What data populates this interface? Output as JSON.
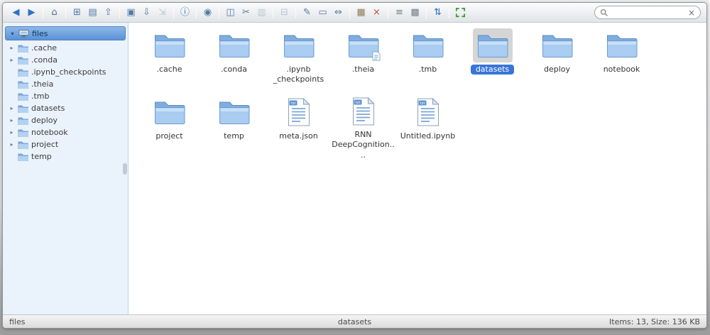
{
  "colors": {
    "accent": "#3875d7",
    "selection_icon_bg": "#d5d5d5",
    "sidebar_bg": "#eaf2fc",
    "tree_selected_top": "#8db7e9",
    "tree_selected_bottom": "#5a92d5"
  },
  "icons": {
    "expanded_arrow": "▾",
    "collapsed_arrow": "▸"
  },
  "search": {
    "placeholder": "",
    "clear_glyph": "×"
  },
  "toolbar": {
    "groups": [
      [
        {
          "name": "back",
          "glyph": "◀",
          "color": "#2d72c4"
        },
        {
          "name": "forward",
          "glyph": "▶",
          "color": "#2d72c4"
        }
      ],
      [
        {
          "name": "home",
          "glyph": "⌂",
          "color": "#4f7396"
        }
      ],
      [
        {
          "name": "new-folder",
          "glyph": "⊞",
          "color": "#4f7aa8"
        },
        {
          "name": "new-file",
          "glyph": "▤",
          "color": "#4f7aa8"
        },
        {
          "name": "upload",
          "glyph": "⇧",
          "color": "#4f7aa8"
        }
      ],
      [
        {
          "name": "open",
          "glyph": "▣",
          "color": "#4f7aa8"
        },
        {
          "name": "download",
          "glyph": "⇩",
          "color": "#4f7aa8"
        },
        {
          "name": "get-url",
          "glyph": "⇲",
          "color": "#4f7aa8",
          "disabled": true
        }
      ],
      [
        {
          "name": "info",
          "glyph": "ⓘ",
          "color": "#2d72c4"
        }
      ],
      [
        {
          "name": "preview",
          "glyph": "◉",
          "color": "#4f7aa8"
        }
      ],
      [
        {
          "name": "copy",
          "glyph": "◫",
          "color": "#4f7aa8"
        },
        {
          "name": "cut",
          "glyph": "✂",
          "color": "#4f7aa8"
        },
        {
          "name": "paste",
          "glyph": "▥",
          "color": "#4f7aa8",
          "disabled": true
        }
      ],
      [
        {
          "name": "duplicate",
          "glyph": "⊟",
          "color": "#4f7aa8",
          "disabled": true
        }
      ],
      [
        {
          "name": "rename",
          "glyph": "✎",
          "color": "#4f7aa8"
        },
        {
          "name": "edit",
          "glyph": "▭",
          "color": "#4f7aa8"
        },
        {
          "name": "resize",
          "glyph": "⇔",
          "color": "#4f7aa8"
        }
      ],
      [
        {
          "name": "archive",
          "glyph": "▦",
          "color": "#8a7a50"
        },
        {
          "name": "delete",
          "glyph": "×",
          "color": "#c0504d"
        }
      ],
      [
        {
          "name": "view-list",
          "glyph": "≡",
          "color": "#6f7e8c"
        },
        {
          "name": "view-icons",
          "glyph": "▩",
          "color": "#6f7e8c"
        }
      ],
      [
        {
          "name": "sort",
          "glyph": "⇅",
          "color": "#2d72c4"
        }
      ],
      [
        {
          "name": "fullscreen",
          "icon": "fullscreen-arrows",
          "color": "#3f9c3f"
        }
      ]
    ]
  },
  "sidebar": {
    "root": {
      "label": "files",
      "expanded": true
    },
    "items": [
      {
        "label": ".cache",
        "expandable": true
      },
      {
        "label": ".conda",
        "expandable": true
      },
      {
        "label": ".ipynb_checkpoints",
        "expandable": false
      },
      {
        "label": ".theia",
        "expandable": false
      },
      {
        "label": ".tmb",
        "expandable": false
      },
      {
        "label": "datasets",
        "expandable": true
      },
      {
        "label": "deploy",
        "expandable": true
      },
      {
        "label": "notebook",
        "expandable": true
      },
      {
        "label": "project",
        "expandable": true
      },
      {
        "label": "temp",
        "expandable": false
      }
    ]
  },
  "files": [
    {
      "label": ".cache",
      "type": "folder"
    },
    {
      "label": ".conda",
      "type": "folder"
    },
    {
      "label": ".ipynb_checkpoints",
      "lines": [
        ".ipynb",
        "_checkpoints"
      ],
      "type": "folder"
    },
    {
      "label": ".theia",
      "type": "folder",
      "badge": true
    },
    {
      "label": ".tmb",
      "type": "folder"
    },
    {
      "label": "datasets",
      "type": "folder",
      "selected": true
    },
    {
      "label": "deploy",
      "type": "folder"
    },
    {
      "label": "notebook",
      "type": "folder"
    },
    {
      "label": "project",
      "type": "folder"
    },
    {
      "label": "temp",
      "type": "folder"
    },
    {
      "label": "meta.json",
      "type": "file"
    },
    {
      "label": "RNN DeepCognition....",
      "lines": [
        "RNN",
        "DeepCognition...."
      ],
      "type": "file"
    },
    {
      "label": "Untitled.ipynb",
      "type": "file"
    }
  ],
  "statusbar": {
    "path": "files",
    "selected": "datasets",
    "info": "Items: 13, Size: 136 KB"
  }
}
